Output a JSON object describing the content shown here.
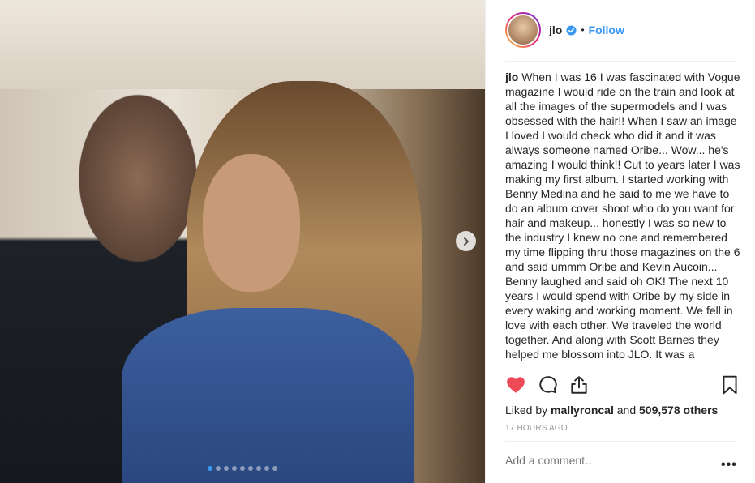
{
  "post": {
    "username": "jlo",
    "follow_label": "Follow",
    "bullet": "•",
    "caption_user": "jlo",
    "caption_text": "When I was 16 I was fascinated with Vogue magazine I would ride on the train and look at all the images of the supermodels and I was obsessed with the hair!! When I saw an image I loved I would check who did it and it was always someone named Oribe... Wow... he's amazing I would think!! Cut to years later I was making my first album. I started working with Benny Medina and he said to me we have to do an album cover shoot who do you want for hair and makeup... honestly I was so new to the industry I knew no one and remembered my time flipping thru those magazines on the 6 and said ummm Oribe and Kevin Aucoin... Benny laughed and said oh OK! The next 10 years I would spend with Oribe by my side in every waking and working moment. We fell in love with each other. We traveled the world together. And along with Scott Barnes they helped me blossom into JLO. It was a",
    "likes_prefix": "Liked by",
    "liked_by_user": "mallyroncal",
    "likes_joiner": "and",
    "likes_count": "509,578 others",
    "timestamp": "17 HOURS AGO",
    "comment_placeholder": "Add a comment…",
    "more_label": "•••"
  },
  "carousel": {
    "slides": 9,
    "active_index": 0
  },
  "colors": {
    "accent": "#3897f0",
    "like_red": "#ed4956",
    "text": "#262626",
    "muted": "#999999"
  },
  "icons": [
    "verified-badge-icon",
    "heart-icon",
    "comment-icon",
    "share-icon",
    "bookmark-icon",
    "chevron-right-icon"
  ]
}
